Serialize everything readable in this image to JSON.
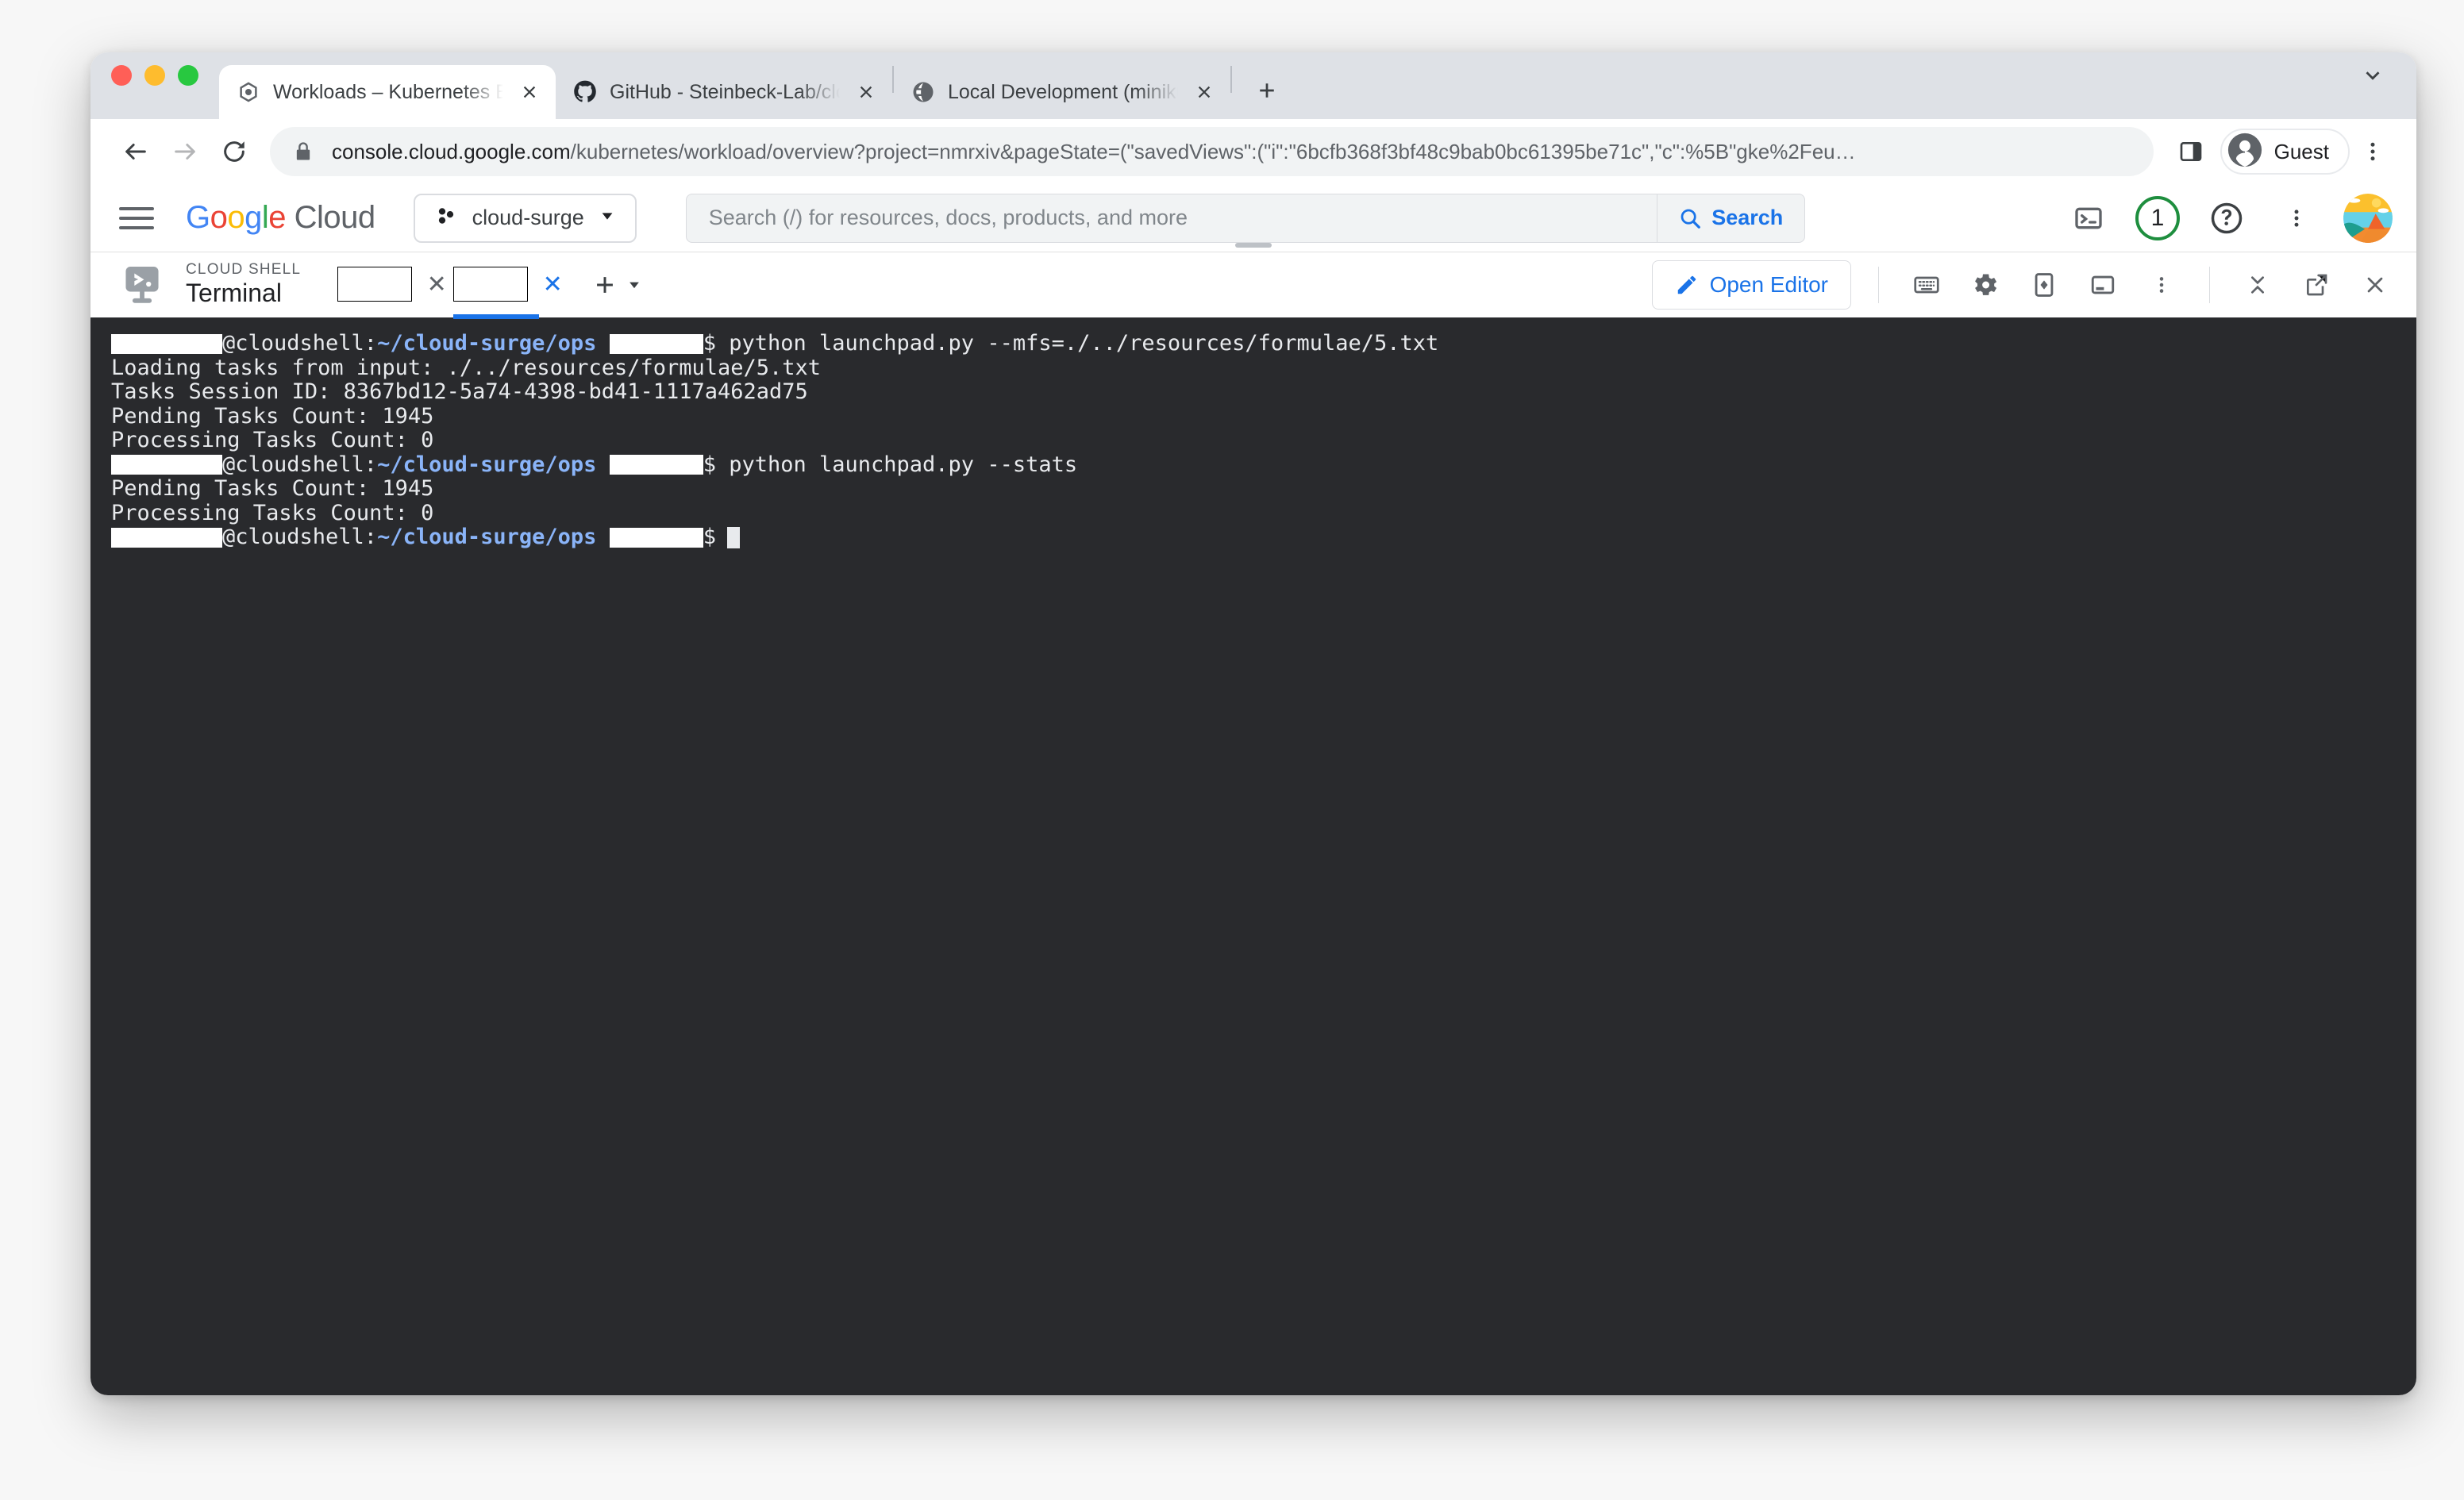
{
  "browser": {
    "tabs": [
      {
        "title": "Workloads – Kubernetes Engin",
        "favicon": "gke-icon",
        "active": true
      },
      {
        "title": "GitHub - Steinbeck-Lab/cloud",
        "favicon": "github-icon",
        "active": false
      },
      {
        "title": "Local Development (minikube)",
        "favicon": "globe-icon",
        "active": false
      }
    ],
    "new_tab_label": "+",
    "url": {
      "host": "console.cloud.google.com",
      "path": "/kubernetes/workload/overview?project=nmrxiv&pageState=(\"savedViews\":(\"i\":\"6bcfb368f3bf48c9bab0bc61395be71c\",\"c\":%5B\"gke%2Feu…"
    },
    "profile_label": "Guest"
  },
  "gcp_header": {
    "logo_text": "Google Cloud",
    "project": "cloud-surge",
    "search_placeholder": "Search (/) for resources, docs, products, and more",
    "search_button": "Search",
    "notification_count": "1"
  },
  "cloud_shell": {
    "eyebrow": "CLOUD SHELL",
    "title": "Terminal",
    "tabs": [
      {
        "label": "",
        "redacted": true,
        "selected": false
      },
      {
        "label": "",
        "redacted": true,
        "selected": true
      }
    ],
    "open_editor_label": "Open Editor"
  },
  "terminal": {
    "host": "@cloudshell:",
    "path": "~/cloud-surge/ops",
    "prompt_symbol": "$",
    "lines": [
      {
        "type": "prompt",
        "command": " python launchpad.py --mfs=./../resources/formulae/5.txt"
      },
      {
        "type": "output",
        "text": "Loading tasks from input: ./../resources/formulae/5.txt"
      },
      {
        "type": "output",
        "text": "Tasks Session ID: 8367bd12-5a74-4398-bd41-1117a462ad75"
      },
      {
        "type": "output",
        "text": "Pending Tasks Count: 1945"
      },
      {
        "type": "output",
        "text": "Processing Tasks Count: 0"
      },
      {
        "type": "prompt",
        "command": " python launchpad.py --stats"
      },
      {
        "type": "output",
        "text": "Pending Tasks Count: 1945"
      },
      {
        "type": "output",
        "text": "Processing Tasks Count: 0"
      },
      {
        "type": "prompt",
        "command": "",
        "cursor": true
      }
    ]
  }
}
